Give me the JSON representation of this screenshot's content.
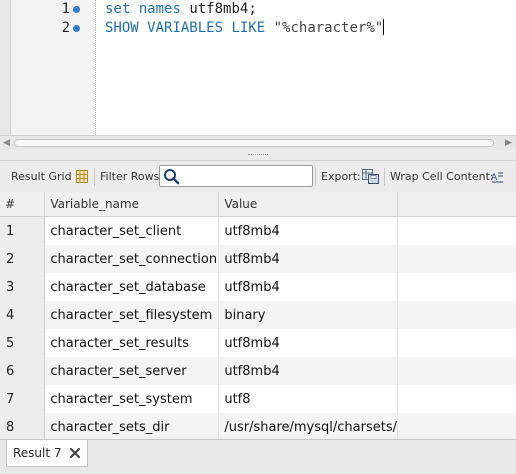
{
  "editor": {
    "lines": [
      {
        "number": "1",
        "tokens": [
          "set",
          "names",
          "utf8mb4;"
        ]
      },
      {
        "number": "2",
        "tokens": [
          "SHOW",
          "VARIABLES",
          "LIKE",
          "\"%character%\""
        ]
      }
    ]
  },
  "toolbar": {
    "result_grid_label": "Result Grid",
    "filter_rows_label": "Filter Rows:",
    "filter_value": "",
    "export_label": "Export:",
    "wrap_label": "Wrap Cell Content:",
    "icons": [
      "grid-icon",
      "search-icon",
      "export-icon",
      "wrap-icon"
    ]
  },
  "grid": {
    "columns": [
      "#",
      "Variable_name",
      "Value"
    ],
    "rows": [
      {
        "idx": "1",
        "name": "character_set_client",
        "value": "utf8mb4"
      },
      {
        "idx": "2",
        "name": "character_set_connection",
        "value": "utf8mb4"
      },
      {
        "idx": "3",
        "name": "character_set_database",
        "value": "utf8mb4"
      },
      {
        "idx": "4",
        "name": "character_set_filesystem",
        "value": "binary"
      },
      {
        "idx": "5",
        "name": "character_set_results",
        "value": "utf8mb4"
      },
      {
        "idx": "6",
        "name": "character_set_server",
        "value": "utf8mb4"
      },
      {
        "idx": "7",
        "name": "character_set_system",
        "value": "utf8"
      },
      {
        "idx": "8",
        "name": "character_sets_dir",
        "value": "/usr/share/mysql/charsets/"
      }
    ]
  },
  "bottom": {
    "tab_label": "Result 7"
  },
  "colors": {
    "keyword": "#1f6fb9",
    "line_marker": "#2d7ecf",
    "row_stripe": "#f4f4f4"
  }
}
